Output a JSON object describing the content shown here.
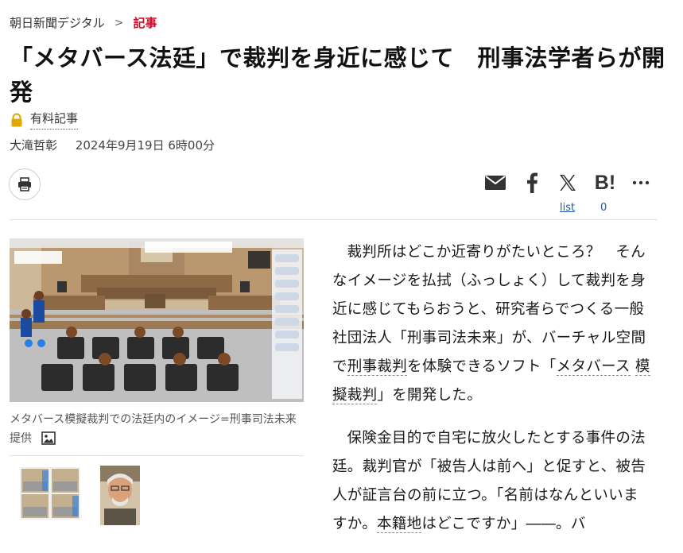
{
  "breadcrumb": {
    "site": "朝日新聞デジタル",
    "separator": ">",
    "current": "記事"
  },
  "article": {
    "title": "「メタバース法廷」で裁判を身近に感じて　刑事法学者らが開発",
    "paid_label": "有料記事",
    "author": "大滝哲彰",
    "date": "2024年9月19日 6時00分"
  },
  "share": {
    "list_label": "list",
    "hatena_count": "0"
  },
  "photo": {
    "caption": "メタバース模擬裁判での法廷内のイメージ=刑事司法未来提供"
  },
  "body": {
    "p1": {
      "before": "裁判所はどこか近寄りがたいところ？　そんなイメージを払拭（ふっしょく）して裁判を身近に感じてもらおうと、研究者らでつくる一般社団法人「刑事司法未来」が、バーチャル空間で",
      "kw1": "刑事裁判",
      "mid": "を体験できるソフト「",
      "kw2": "メタバース",
      "mid2": "",
      "kw3": "模擬裁判",
      "after": "」を開発した。"
    },
    "p2": {
      "before": "保険金目的で自宅に放火したとする事件の法廷。裁判官が「被告人は前へ」と促すと、被告人が証言台の前に立つ。「名前はなんといいますか。",
      "kw1": "本籍地",
      "after": "はどこですか」――。バ"
    }
  },
  "colors": {
    "accent": "#c8102e",
    "link": "#1f5aa6",
    "lock": "#e0a800"
  },
  "icons": [
    "lock-icon",
    "print-icon",
    "mail-icon",
    "facebook-icon",
    "x-icon",
    "hatena-icon",
    "more-icon",
    "image-icon"
  ]
}
